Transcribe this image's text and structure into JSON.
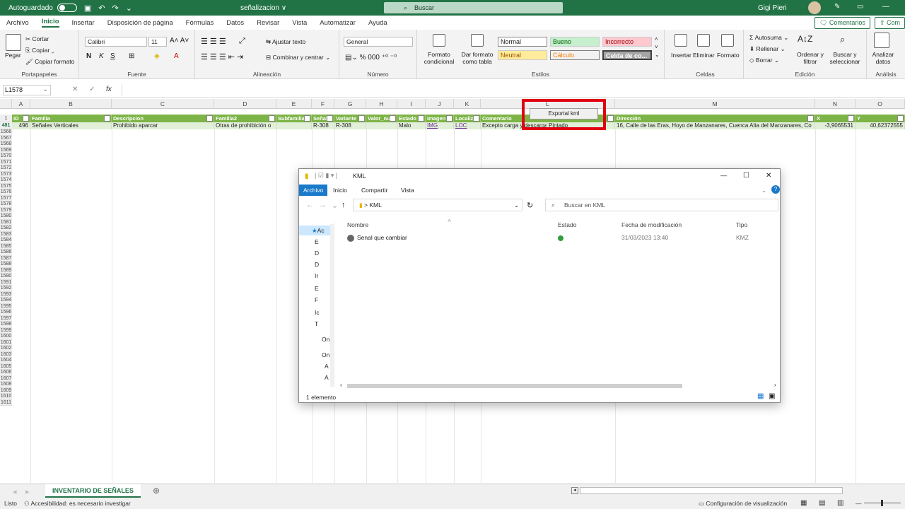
{
  "titlebar": {
    "autosave_label": "Autoguardado",
    "doc_title": "señalizacion ∨",
    "search_placeholder": "Buscar",
    "user_name": "Gigi Pieri"
  },
  "menu": {
    "items": [
      "Archivo",
      "Inicio",
      "Insertar",
      "Disposición de página",
      "Fórmulas",
      "Datos",
      "Revisar",
      "Vista",
      "Automatizar",
      "Ayuda"
    ],
    "active": "Inicio",
    "comments_label": "Comentarios",
    "share_label": "Com"
  },
  "ribbon": {
    "clipboard": {
      "paste": "Pegar",
      "cut": "Cortar",
      "copy": "Copiar",
      "format_copy": "Copiar formato",
      "group": "Portapapeles"
    },
    "font": {
      "name": "Calibri",
      "size": "11",
      "group": "Fuente"
    },
    "alignment": {
      "wrap": "Ajustar texto",
      "merge": "Combinar y centrar",
      "group": "Alineación"
    },
    "number": {
      "format": "General",
      "group": "Número"
    },
    "styles": {
      "conditional": "Formato condicional",
      "as_table": "Dar formato como tabla",
      "normal": "Normal",
      "bueno": "Bueno",
      "incorrecto": "Incorrecto",
      "neutral": "Neutral",
      "calculo": "Cálculo",
      "celda": "Celda de co...",
      "group": "Estilos"
    },
    "cells": {
      "insert": "Insertar",
      "delete": "Eliminar",
      "format": "Formato",
      "group": "Celdas"
    },
    "editing": {
      "autosum": "Autosuma",
      "fill": "Rellenar",
      "clear": "Borrar",
      "sort": "Ordenar y filtrar",
      "find": "Buscar y seleccionar",
      "group": "Edición"
    },
    "analysis": {
      "analyze": "Analizar datos",
      "group": "Análisis"
    }
  },
  "formula_bar": {
    "name_box": "L1578",
    "fx": "fx"
  },
  "columns": [
    "A",
    "B",
    "C",
    "D",
    "E",
    "F",
    "G",
    "H",
    "I",
    "J",
    "K",
    "L",
    "M",
    "N",
    "O"
  ],
  "headers": [
    "ID",
    "Familia",
    "Descripcion",
    "Familia2",
    "Subfamilia",
    "Señal",
    "Variante",
    "Valor_nu",
    "Estado",
    "Imagen",
    "Localiza",
    "Comentario",
    "Dirección",
    "X",
    "Y"
  ],
  "row_481": {
    "row_num": "481",
    "row1_num": "1",
    "id": "496",
    "familia": "Señales Verticales",
    "descripcion": "Prohibido aparcar",
    "familia2": "Otras de prohibición o",
    "senal": "R-308",
    "variante": "R-308",
    "estado": "Malo",
    "imagen": "IMG",
    "localiza": "LOC",
    "comentario": "Excepto carga y descarga",
    "pintado": "Pintado",
    "direccion": "16, Calle de las Eras, Hoyo de Manzanares, Cuenca Alta del Manzanares, Co",
    "x": "-3,9065531",
    "y": "40,62372555"
  },
  "row_numbers": [
    "1566",
    "1567",
    "1568",
    "1569",
    "1570",
    "1571",
    "1572",
    "1573",
    "1574",
    "1575",
    "1576",
    "1577",
    "1578",
    "1579",
    "1580",
    "1581",
    "1582",
    "1583",
    "1584",
    "1585",
    "1586",
    "1587",
    "1588",
    "1589",
    "1590",
    "1591",
    "1592",
    "1593",
    "1594",
    "1595",
    "1596",
    "1597",
    "1598",
    "1599",
    "1600",
    "1601",
    "1602",
    "1603",
    "1604",
    "1605",
    "1606",
    "1607",
    "1608",
    "1609",
    "1610",
    "1611"
  ],
  "export_button": "Exportal kml",
  "explorer": {
    "title": "KML",
    "tabs": [
      "Archivo",
      "Inicio",
      "Compartir",
      "Vista"
    ],
    "address": "KML",
    "search_placeholder": "Buscar en KML",
    "nav": [
      "Ac",
      "E",
      "D",
      "D",
      "Ir",
      "E",
      "F",
      "Ic",
      "T",
      "On",
      "On",
      "A",
      "A"
    ],
    "col_name": "Nombre",
    "col_status": "Estado",
    "col_date": "Fecha de modificación",
    "col_type": "Tipo",
    "file": {
      "name": "Senal que cambiar",
      "date": "31/03/2023 13:40",
      "type": "KMZ"
    },
    "status": "1 elemento",
    "close": "✕",
    "maximize": "☐",
    "minimize": "—"
  },
  "sheet_tab": "INVENTARIO DE SEÑALES",
  "statusbar": {
    "ready": "Listo",
    "accessibility": "Accesibilidad: es necesario investigar",
    "view_settings": "Configuración de visualización"
  }
}
